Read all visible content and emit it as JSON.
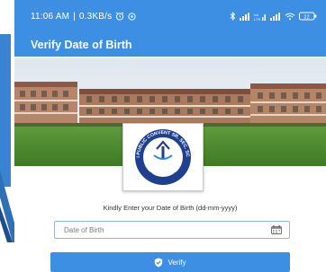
{
  "status_bar": {
    "time": "11:06 AM",
    "speed": "0.3KB/s",
    "battery": "22",
    "icons": [
      "alarm-icon",
      "settings-icon",
      "bluetooth-icon",
      "signal-icon",
      "volte-icon",
      "signal-icon",
      "wifi-icon",
      "battery-icon"
    ]
  },
  "app_bar": {
    "title": "Verify Date of Birth"
  },
  "hero": {
    "image": "school-building-photo"
  },
  "logo": {
    "text_top": "DELHI PUBLIC CONVENT SR. SEC. SCHOOL",
    "text_bottom": "GREATER NOIDA"
  },
  "form": {
    "prompt": "Kindly Enter your Date of Birth (dd-mm-yyyy)",
    "dob_placeholder": "Date of Birth",
    "verify_label": "Verify"
  },
  "colors": {
    "primary": "#3d8fe3",
    "field_border": "#8fb7e6"
  }
}
